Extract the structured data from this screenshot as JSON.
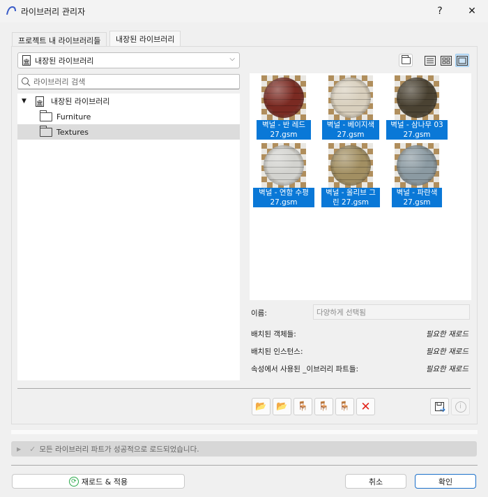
{
  "window": {
    "title": "라이브러리 관리자",
    "help": "?",
    "close": "✕"
  },
  "tabs": [
    {
      "label": "프로젝트 내 라이브러리들"
    },
    {
      "label": "내장된 라이브러리"
    }
  ],
  "library_select": {
    "value": "내장된 라이브러리"
  },
  "search": {
    "placeholder": "라이브러리 검색"
  },
  "tree": {
    "root": "내장된 라이브러리",
    "children": [
      {
        "label": "Furniture"
      },
      {
        "label": "Textures"
      }
    ]
  },
  "thumbnails": [
    {
      "line1": "벽널 - 반 레드",
      "line2": "27.gsm",
      "color": "#7a2a22"
    },
    {
      "line1": "벽널 - 베이지색",
      "line2": "27.gsm",
      "color": "#d8cfbd"
    },
    {
      "line1": "벽널 - 삼나무 03",
      "line2": "27.gsm",
      "color": "#4a4232"
    },
    {
      "line1": "벽널 - 연함 수평",
      "line2": "27.gsm",
      "color": "#d3d3cf"
    },
    {
      "line1": "벽널 - 올리브 그",
      "line2": "린 27.gsm",
      "color": "#a28f62"
    },
    {
      "line1": "벽널 - 파란색",
      "line2": "27.gsm",
      "color": "#8b9aa2"
    }
  ],
  "info": {
    "name_label": "이름:",
    "name_value": "다양하게 선택됨",
    "rows": [
      {
        "label": "배치된 객체들:",
        "value": "필요한 재로드"
      },
      {
        "label": "배치된 인스턴스:",
        "value": "필요한 재로드"
      },
      {
        "label": "속성에서 사용된 _이브러리 파트들:",
        "value": "필요한 재로드"
      }
    ]
  },
  "status": {
    "message": "모든 라이브러리 파트가 성공적으로 로드되었습니다."
  },
  "buttons": {
    "reload": "재로드 & 적용",
    "cancel": "취소",
    "ok": "확인"
  }
}
